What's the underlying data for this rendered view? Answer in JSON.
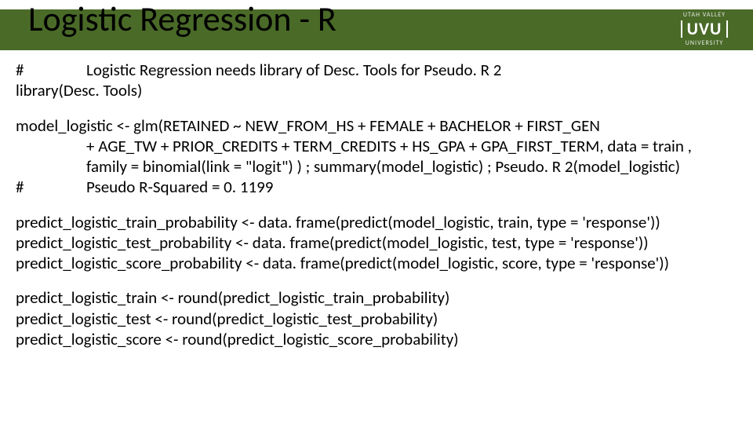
{
  "header": {
    "title": "Logistic Regression - R",
    "logo": {
      "top": "UTAH VALLEY",
      "mid": "UVU",
      "bot": "UNIVERSITY"
    }
  },
  "code": {
    "p1": {
      "hash": "#",
      "comment": "Logistic Regression needs library of Desc. Tools for Pseudo. R 2",
      "lib": "library(Desc. Tools)"
    },
    "p2": {
      "l1": "model_logistic <- glm(RETAINED ~ NEW_FROM_HS + FEMALE + BACHELOR + FIRST_GEN",
      "l2": "+ AGE_TW + PRIOR_CREDITS + TERM_CREDITS + HS_GPA + GPA_FIRST_TERM, data = train ,",
      "l3": "family = binomial(link = \"logit\") )  ;  summary(model_logistic)  ;  Pseudo. R 2(model_logistic)",
      "hash": "#",
      "l4": "Pseudo R-Squared = 0. 1199"
    },
    "p3": {
      "l1": "predict_logistic_train_probability <- data. frame(predict(model_logistic, train, type = 'response'))",
      "l2": "predict_logistic_test_probability <- data. frame(predict(model_logistic, test, type = 'response'))",
      "l3": "predict_logistic_score_probability <- data. frame(predict(model_logistic, score, type = 'response'))"
    },
    "p4": {
      "l1": "predict_logistic_train <- round(predict_logistic_train_probability)",
      "l2": "predict_logistic_test <- round(predict_logistic_test_probability)",
      "l3": "predict_logistic_score <- round(predict_logistic_score_probability)"
    }
  }
}
